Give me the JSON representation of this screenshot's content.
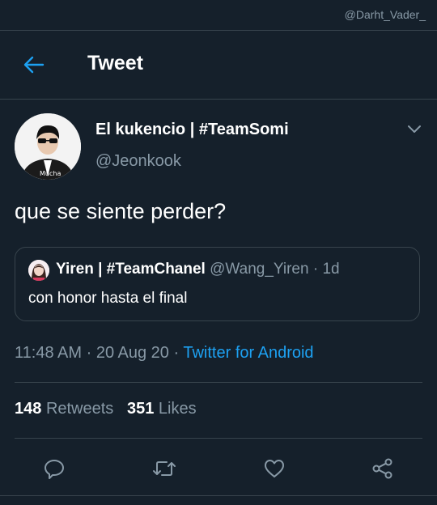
{
  "watermark": "@Darht_Vader_",
  "header": {
    "title": "Tweet"
  },
  "tweet": {
    "display_name": "El kukencio | #TeamSomi",
    "handle": "@Jeonkook",
    "avatar_caption": "Mucha",
    "text": "que se siente perder?",
    "time": "11:48 AM",
    "date": "20 Aug 20",
    "source": "Twitter for Android",
    "retweets_count": "148",
    "retweets_label": "Retweets",
    "likes_count": "351",
    "likes_label": "Likes"
  },
  "quoted": {
    "display_name": "Yiren | #TeamChanel",
    "handle": "@Wang_Yiren",
    "age": "1d",
    "text": "con honor hasta el final"
  },
  "colors": {
    "background": "#15202b",
    "accent": "#1da1f2",
    "secondary_text": "#8899a6",
    "border": "#38444d"
  },
  "icons": [
    "back-arrow-icon",
    "chevron-down-icon",
    "reply-icon",
    "retweet-icon",
    "like-icon",
    "share-icon"
  ]
}
